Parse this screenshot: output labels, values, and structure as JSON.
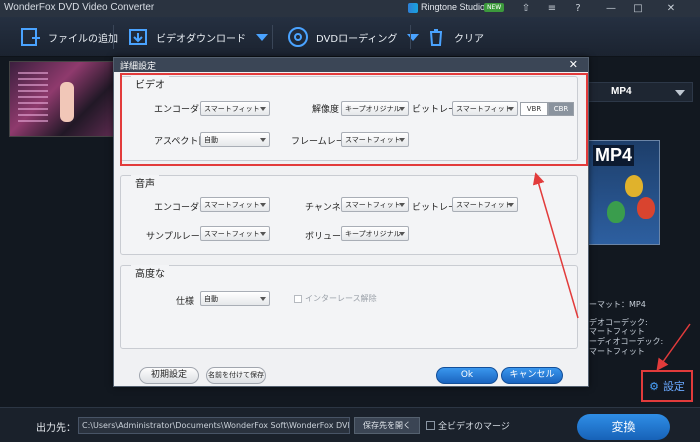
{
  "app": {
    "title": "WonderFox DVD Video Converter",
    "ringtone_studio": "Ringtone Studio",
    "new_badge": "NEW"
  },
  "toolbar": {
    "add_files": "ファイルの追加",
    "video_download": "ビデオダウンロード",
    "dvd_loading": "DVDローディング",
    "clear": "クリア"
  },
  "output_format": {
    "value": "MP4",
    "art_label": "MP4"
  },
  "right_info": {
    "format": "ーマット：MP4",
    "video_codec_label": "デオコーデック:",
    "video_codec_value": "マートフィット",
    "audio_codec_label": "ーディオコーデック:",
    "audio_codec_value": "マートフィット"
  },
  "settings_link": "設定",
  "bottom": {
    "output_label": "出力先：",
    "output_path": "C:\\Users\\Administrator\\Documents\\WonderFox Soft\\WonderFox DVD Vic",
    "open_folder": "保存先を開く",
    "merge_all": "全ビデオのマージ",
    "convert": "変換"
  },
  "dialog": {
    "title": "詳細設定",
    "close": "✕",
    "video": {
      "heading": "ビデオ",
      "encoder_label": "エンコーダー",
      "encoder_value": "スマートフィット",
      "resolution_label": "解像度",
      "resolution_value": "キープオリジナル",
      "bitrate_label": "ビットレート",
      "bitrate_value": "スマートフィット",
      "vbr": "VBR",
      "cbr": "CBR",
      "aspect_label": "アスペクト比",
      "aspect_value": "自動",
      "framerate_label": "フレームレート",
      "framerate_value": "スマートフィット"
    },
    "audio": {
      "heading": "音声",
      "encoder_label": "エンコーダー",
      "encoder_value": "スマートフィット",
      "channel_label": "チャンネル",
      "channel_value": "スマートフィット",
      "bitrate_label": "ビットレート",
      "bitrate_value": "スマートフィット",
      "samplerate_label": "サンプルレート",
      "samplerate_value": "スマートフィット",
      "volume_label": "ボリューム",
      "volume_value": "キープオリジナル"
    },
    "advanced": {
      "heading": "高度な",
      "spec_label": "仕様",
      "spec_value": "自動",
      "deinterlace": "インターレース解除"
    },
    "buttons": {
      "reset": "初期設定",
      "save_as": "名前を付けて保存",
      "ok": "Ok",
      "cancel": "キャンセル"
    }
  },
  "colors": {
    "highlight": "#e23b3b",
    "accent": "#2f8ee6"
  }
}
